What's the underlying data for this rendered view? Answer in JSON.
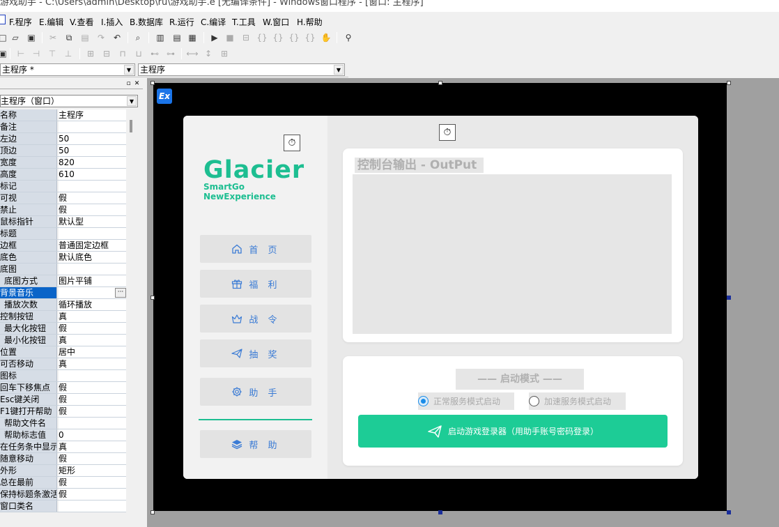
{
  "window": {
    "title": "游戏助手 - C:\\Users\\admin\\Desktop\\ru\\游戏助手.e [无编译条件] - Windows窗口程序 - [窗口: 主程序]"
  },
  "menu": [
    {
      "label": "F.程序"
    },
    {
      "label": "E.编辑"
    },
    {
      "label": "V.查看"
    },
    {
      "label": "I.插入"
    },
    {
      "label": "B.数据库"
    },
    {
      "label": "R.运行"
    },
    {
      "label": "C.编译"
    },
    {
      "label": "T.工具"
    },
    {
      "label": "W.窗口"
    },
    {
      "label": "H.帮助"
    }
  ],
  "combos": {
    "window_select": "主程序 *",
    "sub_select": "主程序"
  },
  "properties": {
    "object_select": "主程序（窗口）",
    "rows": [
      {
        "name": "名称",
        "value": "主程序"
      },
      {
        "name": "备注",
        "value": ""
      },
      {
        "name": "左边",
        "value": "50"
      },
      {
        "name": "顶边",
        "value": "50"
      },
      {
        "name": "宽度",
        "value": "820"
      },
      {
        "name": "高度",
        "value": "610"
      },
      {
        "name": "标记",
        "value": ""
      },
      {
        "name": "可视",
        "value": "假"
      },
      {
        "name": "禁止",
        "value": "假"
      },
      {
        "name": "鼠标指针",
        "value": "默认型"
      },
      {
        "name": "标题",
        "value": ""
      },
      {
        "name": "边框",
        "value": "普通固定边框"
      },
      {
        "name": "底色",
        "value": "默认底色"
      },
      {
        "name": "底图",
        "value": ""
      },
      {
        "name": "底图方式",
        "value": "图片平铺"
      },
      {
        "name": "背景音乐",
        "value": ""
      },
      {
        "name": "播放次数",
        "value": "循环播放"
      },
      {
        "name": "控制按钮",
        "value": "真"
      },
      {
        "name": "最大化按钮",
        "value": "假"
      },
      {
        "name": "最小化按钮",
        "value": "真"
      },
      {
        "name": "位置",
        "value": "居中"
      },
      {
        "name": "可否移动",
        "value": "真"
      },
      {
        "name": "图标",
        "value": ""
      },
      {
        "name": "回车下移焦点",
        "value": "假"
      },
      {
        "name": "Esc键关闭",
        "value": "假"
      },
      {
        "name": "F1键打开帮助",
        "value": "假"
      },
      {
        "name": "帮助文件名",
        "value": ""
      },
      {
        "name": "帮助标志值",
        "value": "0"
      },
      {
        "name": "在任务条中显示",
        "value": "真"
      },
      {
        "name": "随意移动",
        "value": "假"
      },
      {
        "name": "外形",
        "value": "矩形"
      },
      {
        "name": "总在最前",
        "value": "假"
      },
      {
        "name": "保持标题条激活",
        "value": "假"
      },
      {
        "name": "窗口类名",
        "value": ""
      }
    ]
  },
  "form": {
    "brand": "Glacier",
    "sub1": "SmartGo",
    "sub2": "NewExperience",
    "nav": [
      {
        "label": "首 页",
        "icon": "home-icon"
      },
      {
        "label": "福 利",
        "icon": "gift-icon"
      },
      {
        "label": "战 令",
        "icon": "crown-icon"
      },
      {
        "label": "抽 奖",
        "icon": "send-icon"
      },
      {
        "label": "助 手",
        "icon": "gear-icon"
      },
      {
        "label": "帮 助",
        "icon": "layers-icon"
      }
    ],
    "output_title": "控制台输出 - OutPut",
    "mode_title": "—— 启动模式 ——",
    "radio_normal": "正常服务模式启动",
    "radio_boost": "加速服务模式启动",
    "start_button": "启动游戏登录器（用助手账号密码登录）",
    "colors": {
      "accent": "#1dbe91",
      "button": "#1dcc96",
      "nav_text": "#3a7bd5",
      "close": "#e62b2b"
    }
  }
}
